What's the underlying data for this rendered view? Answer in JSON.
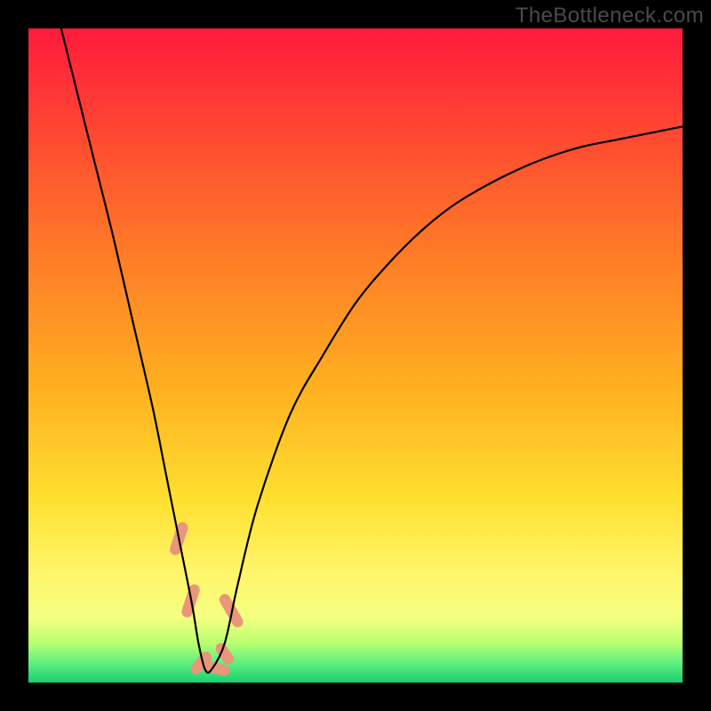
{
  "watermark": "TheBottleneck.com",
  "chart_data": {
    "type": "line",
    "title": "",
    "xlabel": "",
    "ylabel": "",
    "xlim": [
      0,
      100
    ],
    "ylim": [
      0,
      100
    ],
    "axes_visible": false,
    "grid": false,
    "background_gradient": {
      "stops": [
        {
          "offset": 0.0,
          "color": "#ff1a3c"
        },
        {
          "offset": 0.28,
          "color": "#ff6a2a"
        },
        {
          "offset": 0.55,
          "color": "#ffb020"
        },
        {
          "offset": 0.72,
          "color": "#ffe030"
        },
        {
          "offset": 0.83,
          "color": "#fff56a"
        },
        {
          "offset": 0.9,
          "color": "#f5ff80"
        },
        {
          "offset": 0.94,
          "color": "#b8ff70"
        },
        {
          "offset": 0.97,
          "color": "#60f080"
        },
        {
          "offset": 1.0,
          "color": "#18d070"
        }
      ]
    },
    "series": [
      {
        "name": "curve",
        "color": "#000000",
        "x": [
          5,
          8,
          10,
          13,
          16,
          19,
          21,
          23,
          25,
          26,
          27,
          28,
          30,
          32,
          35,
          40,
          45,
          50,
          55,
          60,
          65,
          70,
          75,
          80,
          85,
          90,
          95,
          100
        ],
        "values": [
          100,
          88,
          80,
          68,
          55,
          42,
          32,
          22,
          12,
          6,
          2,
          2,
          6,
          15,
          27,
          41,
          50,
          58,
          64,
          69,
          73,
          76,
          78.5,
          80.5,
          82,
          83,
          84,
          85
        ]
      }
    ],
    "markers": [
      {
        "name": "marker-left-upper",
        "shape": "pill",
        "color": "#e9967a",
        "x": 23.0,
        "y": 22.0,
        "angle": -72,
        "len": 5.2
      },
      {
        "name": "marker-left-lower",
        "shape": "pill",
        "color": "#e9967a",
        "x": 24.8,
        "y": 12.5,
        "angle": -72,
        "len": 5.2
      },
      {
        "name": "marker-bottom-1",
        "shape": "pill",
        "color": "#e9967a",
        "x": 26.4,
        "y": 3.0,
        "angle": -50,
        "len": 4.0
      },
      {
        "name": "marker-bottom-2",
        "shape": "pill",
        "color": "#e9967a",
        "x": 28.3,
        "y": 2.3,
        "angle": 15,
        "len": 5.0
      },
      {
        "name": "marker-right-upper",
        "shape": "pill",
        "color": "#e9967a",
        "x": 31.0,
        "y": 11.0,
        "angle": 60,
        "len": 5.6
      },
      {
        "name": "marker-right-lower",
        "shape": "pill",
        "color": "#e9967a",
        "x": 30.0,
        "y": 4.4,
        "angle": 55,
        "len": 3.6
      }
    ]
  }
}
